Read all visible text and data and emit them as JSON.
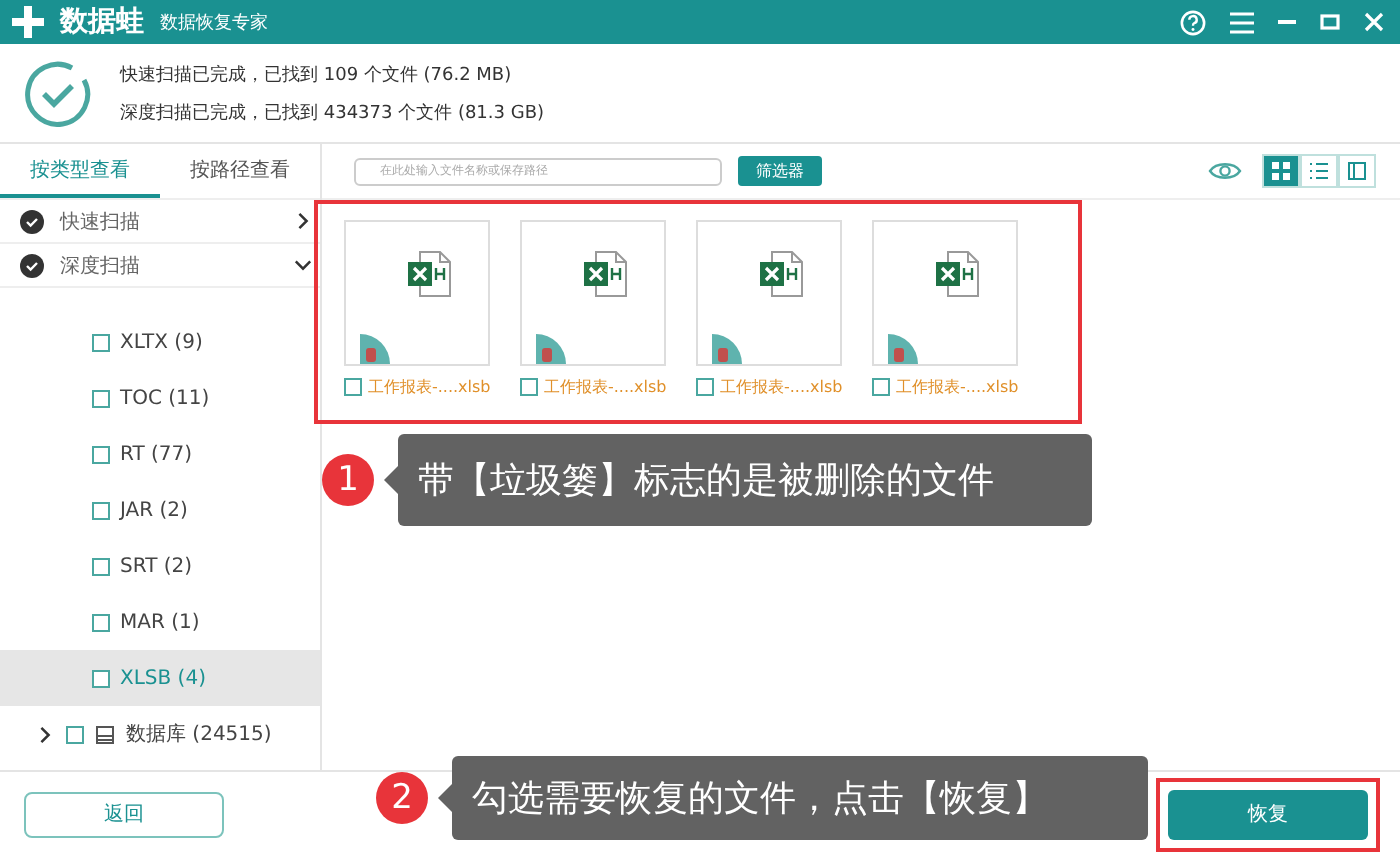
{
  "title_bar": {
    "app_name": "数据蛙",
    "subtitle": "数据恢复专家"
  },
  "scan_summary": [
    "快速扫描已完成，已找到 109 个文件 (76.2 MB)",
    "深度扫描已完成，已找到 434373 个文件 (81.3 GB)"
  ],
  "sidebar": {
    "tabs": [
      {
        "label": "按类型查看",
        "selected": true
      },
      {
        "label": "按路径查看",
        "selected": false
      }
    ],
    "scans": [
      {
        "label": "快速扫描",
        "expanded": false
      },
      {
        "label": "深度扫描",
        "expanded": true
      }
    ],
    "items": [
      {
        "label": "XLTX (9)",
        "selected": false,
        "checked": false
      },
      {
        "label": "TOC (11)",
        "selected": false,
        "checked": false
      },
      {
        "label": "RT (77)",
        "selected": false,
        "checked": false
      },
      {
        "label": "JAR (2)",
        "selected": false,
        "checked": false
      },
      {
        "label": "SRT (2)",
        "selected": false,
        "checked": false
      },
      {
        "label": "MAR (1)",
        "selected": false,
        "checked": false
      },
      {
        "label": "XLSB (4)",
        "selected": true,
        "checked": false
      }
    ],
    "folder": {
      "label": "数据库 (24515)",
      "expanded": false,
      "checked": false
    }
  },
  "toolbar": {
    "search_placeholder": "在此处输入文件名称或保存路径",
    "filter_button": "筛选器",
    "views": [
      {
        "kind": "grid",
        "selected": true
      },
      {
        "kind": "list",
        "selected": false
      },
      {
        "kind": "preview",
        "selected": false
      }
    ]
  },
  "files": [
    {
      "name": "工作报表-....xlsb",
      "deleted": true,
      "checked": false
    },
    {
      "name": "工作报表-....xlsb",
      "deleted": true,
      "checked": false
    },
    {
      "name": "工作报表-....xlsb",
      "deleted": true,
      "checked": false
    },
    {
      "name": "工作报表-....xlsb",
      "deleted": true,
      "checked": false
    }
  ],
  "callouts": [
    {
      "number": "1",
      "text": "带【垃圾篓】标志的是被删除的文件"
    },
    {
      "number": "2",
      "text": "勾选需要恢复的文件，点击【恢复】"
    }
  ],
  "buttons": {
    "back": "返回",
    "recover": "恢复"
  }
}
